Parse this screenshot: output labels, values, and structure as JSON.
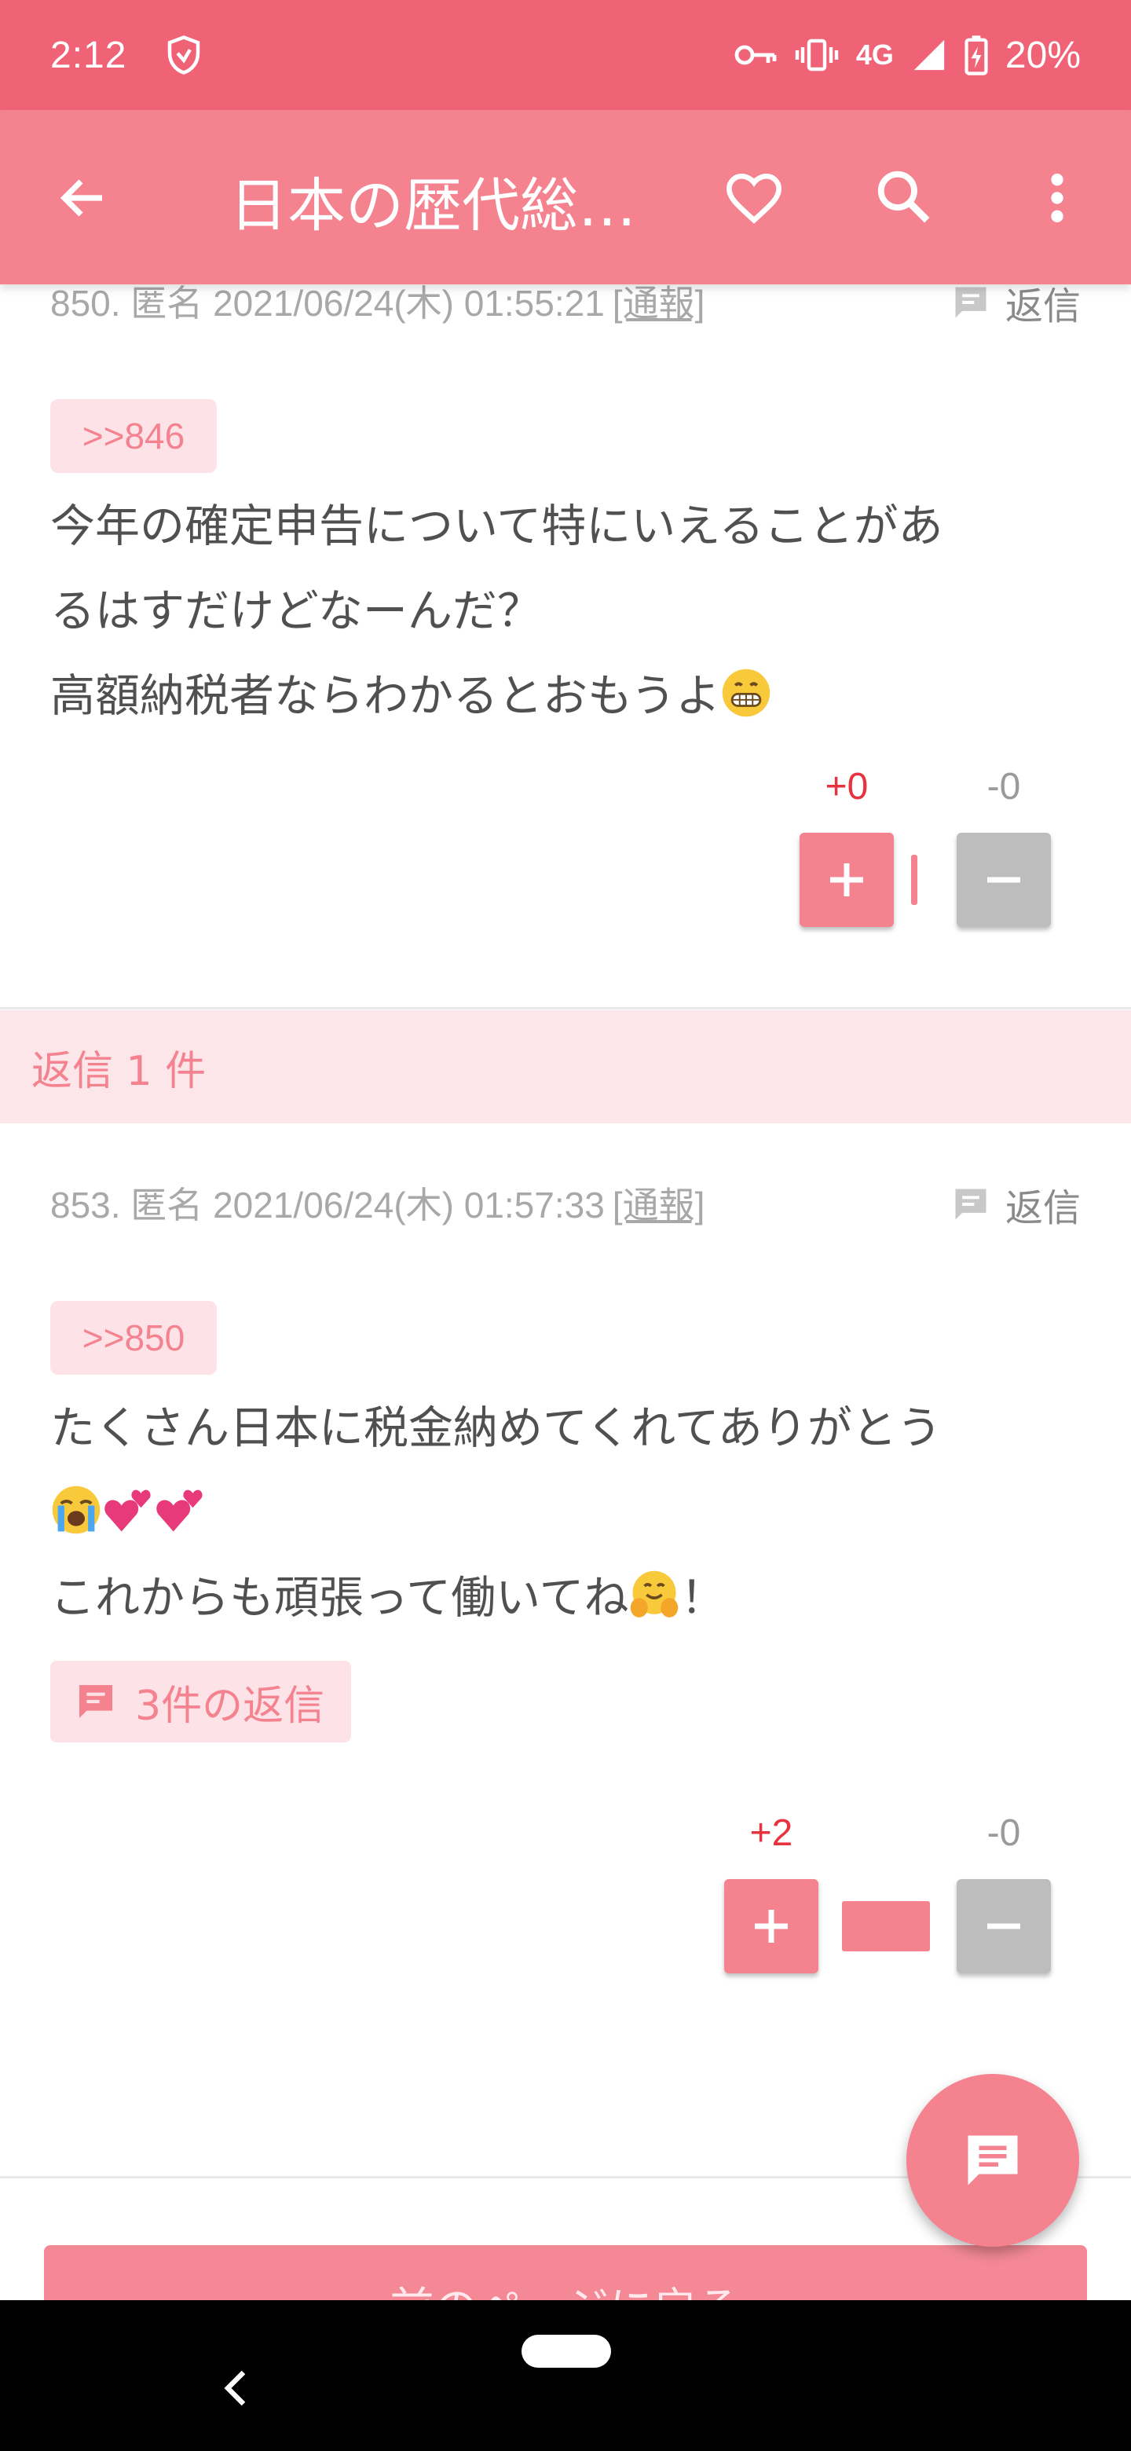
{
  "status_bar": {
    "time": "2:12",
    "network": "4G",
    "battery": "20%"
  },
  "app_bar": {
    "title": "日本の歴代総…"
  },
  "posts": [
    {
      "meta": "850. 匿名 2021/06/24(木) 01:55:21",
      "report_label": "[通報]",
      "reply_label": "返信",
      "anchor": ">>846",
      "body_lines": [
        "今年の確定申告について特にいえることがあ",
        "るはすだけどなーんだ？",
        "高額納税者ならわかるとおもうよ"
      ],
      "emoji": [
        "grinning-face-with-smiling-eyes"
      ],
      "vote_plus": "+0",
      "vote_minus": "-0",
      "plus_ratio": 0.0
    },
    {
      "meta": "853. 匿名 2021/06/24(木) 01:57:33",
      "report_label": "[通報]",
      "reply_label": "返信",
      "anchor": ">>850",
      "body_lines": [
        "たくさん日本に税金納めてくれてありがとう",
        "",
        "これからも頑張って働いてね"
      ],
      "body_tail": "！",
      "emoji": [
        "loudly-crying-face",
        "two-hearts",
        "two-hearts",
        "hugging-face"
      ],
      "replies_label": "3件の返信",
      "vote_plus": "+2",
      "vote_minus": "-0",
      "plus_ratio": 1.0
    }
  ],
  "reply_section": {
    "label": "返信 1 件"
  },
  "prev_page_button": "前のページに戻る",
  "colors": {
    "status_bar": "#f06377",
    "app_bar": "#f4828f",
    "accent": "#f4828f",
    "chip_bg": "#fde3e7",
    "vote_plus_text": "#e8333f",
    "vote_minus_bg": "#bdbdbd"
  },
  "icons": {
    "fab": "comment-icon"
  }
}
